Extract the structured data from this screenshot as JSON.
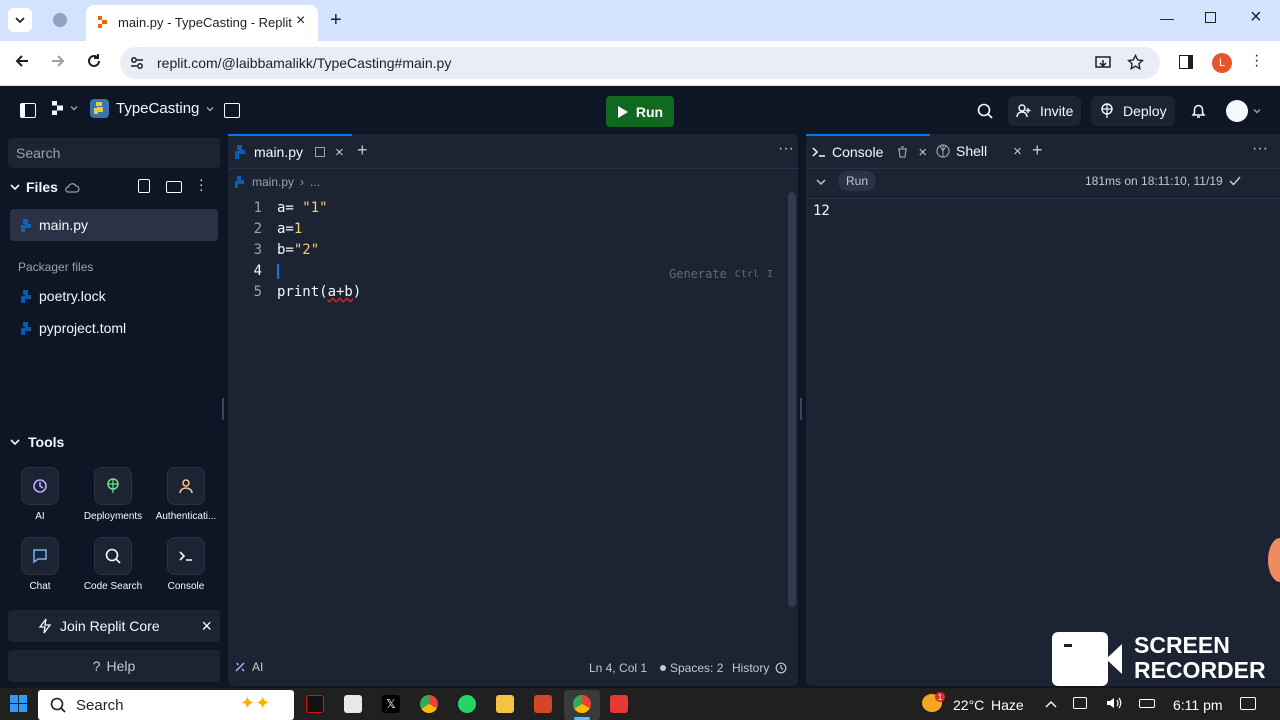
{
  "browser": {
    "tab_title": "main.py - TypeCasting - Replit",
    "url": "replit.com/@laibbamalikk/TypeCasting#main.py",
    "profile_initial": "L"
  },
  "header": {
    "repl_name": "TypeCasting",
    "run_label": "Run",
    "invite_label": "Invite",
    "deploy_label": "Deploy"
  },
  "sidebar": {
    "search_placeholder": "Search",
    "files_label": "Files",
    "files": [
      "main.py"
    ],
    "packager_label": "Packager files",
    "packager_files": [
      "poetry.lock",
      "pyproject.toml"
    ],
    "tools_label": "Tools",
    "tools": [
      "AI",
      "Deployments",
      "Authenticati...",
      "Chat",
      "Code Search",
      "Console"
    ],
    "join_label": "Join Replit Core",
    "help_label": "Help"
  },
  "editor": {
    "tab_label": "main.py",
    "breadcrumb_file": "main.py",
    "breadcrumb_more": "...",
    "line_numbers": [
      "1",
      "2",
      "3",
      "4",
      "5"
    ],
    "lines": {
      "l1_var": "a=",
      "l1_str": " \"1\"",
      "l2_var": "a=",
      "l2_num": "1",
      "l3_var": "b=",
      "l3_str": "\"2\"",
      "l5_fn": "print(",
      "l5_arg": "a+b",
      "l5_close": ")"
    },
    "generate_hint": "Generate",
    "generate_shortcut": "Ctrl",
    "generate_key": "I",
    "status_ai": "AI",
    "status_pos": "Ln 4, Col 1",
    "status_spaces": "Spaces: 2",
    "status_history": "History"
  },
  "console": {
    "tab_console": "Console",
    "tab_shell": "Shell",
    "run_chip": "Run",
    "run_info": "181ms on 18:11:10, 11/19",
    "output": "12"
  },
  "overlay": {
    "recorder_line1": "SCREEN",
    "recorder_line2": "RECORDER"
  },
  "taskbar": {
    "search_label": "Search",
    "temperature": "22°C",
    "weather": "Haze",
    "time": "6:11 pm",
    "weather_badge": "1"
  }
}
